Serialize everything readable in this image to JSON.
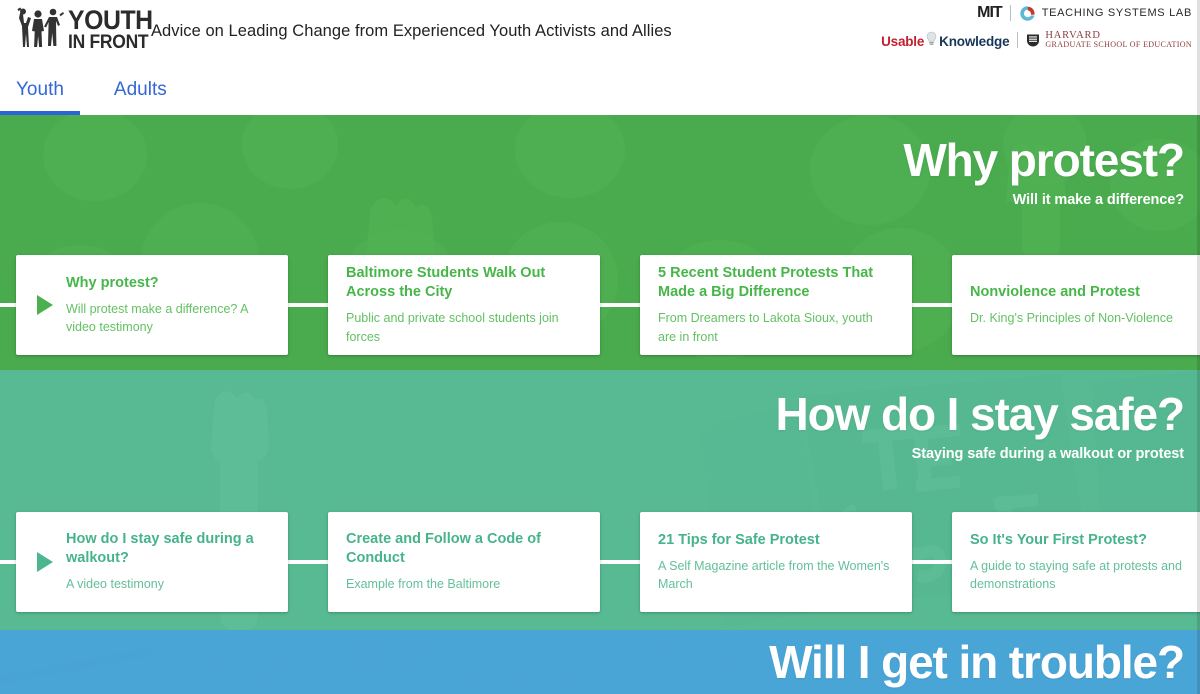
{
  "header": {
    "logo": {
      "line1": "YOUTH",
      "line2": "IN FRONT",
      "icon": "three-activists-icon"
    },
    "tagline": "Advice on Leading Change from Experienced Youth Activists and Allies",
    "partners": {
      "mit": "MIT",
      "teaching_systems_lab": "TEACHING SYSTEMS LAB",
      "usable": "Usable",
      "knowledge": "Knowledge",
      "harvard_line1": "HARVARD",
      "harvard_line2": "GRADUATE SCHOOL OF EDUCATION"
    }
  },
  "tabs": [
    {
      "label": "Youth",
      "active": true
    },
    {
      "label": "Adults",
      "active": false
    }
  ],
  "colors": {
    "tab_active": "#2a64d8",
    "tab_text": "#3367d6",
    "green": "#4caf50",
    "teal": "#5abd95",
    "blue": "#4ca7d8",
    "card_green_title": "#47b649",
    "card_green_desc": "#63c163",
    "card_teal_title": "#46b38b",
    "card_teal_desc": "#64bf9b"
  },
  "sections": [
    {
      "id": "why-protest",
      "title": "Why protest?",
      "subtitle": "Will it make a difference?",
      "theme": "green",
      "background": "crowd-of-protesters-photo",
      "cards": [
        {
          "title": "Why protest?",
          "desc": "Will protest make a difference? A video testimony",
          "has_play": true
        },
        {
          "title": "Baltimore Students Walk Out Across the City",
          "desc": "Public and private school students join forces",
          "has_play": false
        },
        {
          "title": "5 Recent Student Protests That Made a Big Difference",
          "desc": "From Dreamers to Lakota Sioux, youth are in front",
          "has_play": false
        },
        {
          "title": "Nonviolence and Protest",
          "desc": "Dr. King's Principles of Non-Violence",
          "has_play": false
        }
      ]
    },
    {
      "id": "stay-safe",
      "title": "How do I stay safe?",
      "subtitle": "Staying safe during a walkout or protest",
      "theme": "teal",
      "background": "raised-fist-and-protest-sign-photo",
      "cards": [
        {
          "title": "How do I stay safe during a walkout?",
          "desc": "A video testimony",
          "has_play": true
        },
        {
          "title": "Create and Follow a Code of Conduct",
          "desc": "Example from the Baltimore",
          "has_play": false
        },
        {
          "title": "21 Tips for Safe Protest",
          "desc": "A Self Magazine article from the Women's March",
          "has_play": false
        },
        {
          "title": "So It's Your First Protest?",
          "desc": "A guide to staying safe at protests and demonstrations",
          "has_play": false
        }
      ]
    },
    {
      "id": "get-in-trouble",
      "title": "Will I get in trouble?",
      "subtitle": "",
      "theme": "blue",
      "background": "respect-protest-sign-photo",
      "cards": []
    }
  ]
}
